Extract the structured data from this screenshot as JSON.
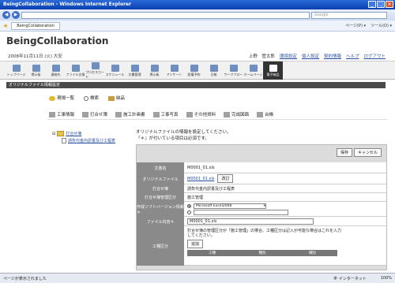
{
  "window": {
    "title": "BeingCollaboration - Windows Internet Explorer",
    "minimize": "_",
    "maximize": "□",
    "close": "×"
  },
  "browser": {
    "back": "◀",
    "forward": "▶",
    "search_placeholder": "Google",
    "tab_label": "BeingCollaboration",
    "tools": [
      "ページ(P) ▾",
      "ツール(O) ▾"
    ]
  },
  "app": {
    "brand": "BeingCollaboration",
    "date": "2008年11月11日 (火) 大安",
    "user_name": "上野　管太郎",
    "links": [
      "環境設定",
      "個人設定",
      "契約情報",
      "ヘルプ",
      "ログアウト"
    ]
  },
  "toolbar": {
    "items": [
      "トップページ",
      "掲示板",
      "連絡先",
      "ファイル交換",
      "プロセスカード",
      "スケジュール",
      "文書管理",
      "掲示板",
      "アンケート",
      "設備予約",
      "日報",
      "ワークフロー",
      "ホームページ",
      "電子納品"
    ]
  },
  "section_title": "オリジナルファイル情報設定",
  "top_links": [
    "現場一覧",
    "検索",
    "納品"
  ],
  "categories": [
    "工事情報",
    "打合せ簿",
    "施工計画書",
    "工事写真",
    "その他資料",
    "完成図面",
    "台帳"
  ],
  "tree": {
    "folder": "打合せ簿",
    "file": "請負代金内訳書及び工程表"
  },
  "message": {
    "line1": "オリジナルファイルの情報を設定してください。",
    "line2": "『＊』が付いている項目は必須です。"
  },
  "form": {
    "save": "保存",
    "cancel": "キャンセル",
    "doc_name_label": "文書名",
    "doc_name": "M0001_01.xls",
    "original_label": "オリジナルファイル",
    "original_value": "M0001_01.xls",
    "change_button": "改訂",
    "meeting_label": "打合せ簿",
    "meeting_value": "請負代金内訳書及び工程表",
    "category_label": "打合せ簿管理区分",
    "category_value": "施工管理",
    "software_label": "作成ソフトバージョン情報＊",
    "software_option": "Microsoft Excel2008",
    "filename_label": "ファイル内容＊",
    "filename_value": "M0001_01.xls",
    "section_label": "工種区分",
    "section_desc": "打合せ簿の管理区分が「施工管理」の場合、工種区分は記入が可能な場合はこれを入力してください。",
    "add_button": "追加",
    "columns": [
      "工種",
      "種別",
      "細別"
    ]
  },
  "status": {
    "left": "ページが表示されました",
    "zone": "インターネット",
    "zoom": "100%"
  }
}
